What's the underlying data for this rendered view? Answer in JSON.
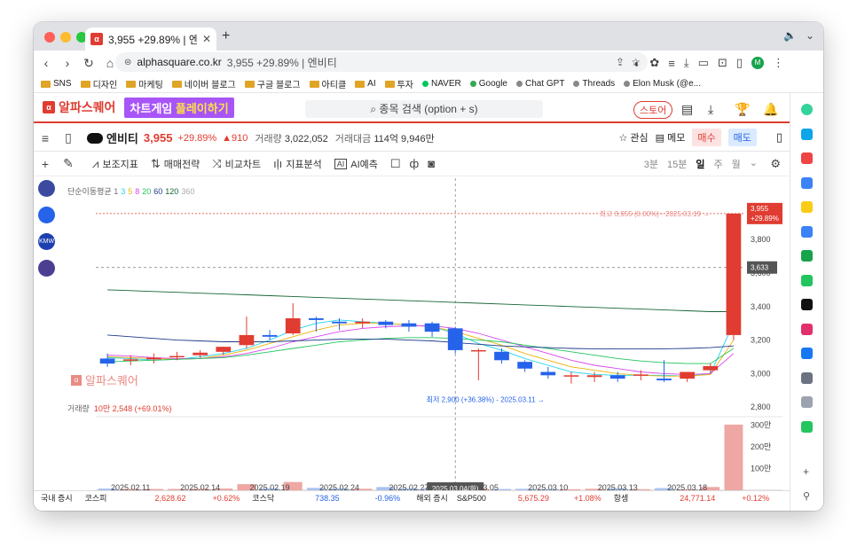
{
  "browser": {
    "tab_title": "3,955 +29.89% | 엔비티",
    "favicon": "α",
    "url_host": "alphasquare.co.kr",
    "url_rest": "3,955 +29.89% | 엔비티",
    "profile_initial": "M"
  },
  "bookmarks": [
    {
      "label": "SNS",
      "type": "folder"
    },
    {
      "label": "디자인",
      "type": "folder"
    },
    {
      "label": "마케팅",
      "type": "folder"
    },
    {
      "label": "네이버 블로그",
      "type": "folder"
    },
    {
      "label": "구글 블로그",
      "type": "folder"
    },
    {
      "label": "아티클",
      "type": "folder"
    },
    {
      "label": "AI",
      "type": "folder"
    },
    {
      "label": "투자",
      "type": "folder"
    },
    {
      "label": "NAVER",
      "type": "site",
      "color": "#03c75a"
    },
    {
      "label": "Google",
      "type": "site",
      "color": "#34a853"
    },
    {
      "label": "Chat GPT",
      "type": "site",
      "color": "#888888"
    },
    {
      "label": "Threads",
      "type": "site",
      "color": "#888888"
    },
    {
      "label": "Elon Musk (@e...",
      "type": "site",
      "color": "#888888"
    }
  ],
  "app": {
    "logo_text": "알파스퀘어",
    "promo_a": "차트게임 ",
    "promo_b": "플레이하기",
    "search_placeholder": "종목 검색 (option + s)",
    "store_label": "스토어"
  },
  "stock": {
    "name": "엔비티",
    "price": "3,955",
    "pct": "+29.89%",
    "change": "▲910",
    "volume_label": "거래량",
    "volume": "3,022,052",
    "amount_label": "거래대금",
    "amount": "114억 9,946만",
    "watch_label": "관심",
    "memo_label": "메모",
    "buy_label": "매수",
    "sell_label": "매도"
  },
  "chart_toolbar": {
    "indicator_label": "보조지표",
    "strategy_label": "매매전략",
    "compare_label": "비교차트",
    "analysis_label": "지표분석",
    "ai_label": "AI예측",
    "periods": [
      "3분",
      "15분",
      "일",
      "주",
      "월"
    ],
    "active_period": "일"
  },
  "overlays": {
    "ma_title": "단순이동평균",
    "ma_periods": [
      {
        "label": "1",
        "color": "#6b7280"
      },
      {
        "label": "3",
        "color": "#22d3ee"
      },
      {
        "label": "5",
        "color": "#eab308"
      },
      {
        "label": "8",
        "color": "#d946ef"
      },
      {
        "label": "20",
        "color": "#22c55e"
      },
      {
        "label": "60",
        "color": "#1e3a8a"
      },
      {
        "label": "120",
        "color": "#166534"
      },
      {
        "label": "360",
        "color": "#aaaaaa"
      }
    ],
    "high_label": "최고 3,955 (0.00%) - 2025.03.19 →",
    "low_label": "최저 2,900 (+36.38%) - 2025.03.11 →",
    "last_price_tag": "3,955",
    "last_pct_tag": "+29.89%",
    "cursor_price": "3,633",
    "cursor_date": "2025.03.04(화)",
    "volume_title": "거래량",
    "volume_value": "10만 2,548 (+69.01%)",
    "watermark": "알파스퀘어"
  },
  "chart_data": {
    "type": "candlestick",
    "price_axis": {
      "min": 2780,
      "max": 4060,
      "ticks": [
        2800,
        3000,
        3200,
        3400,
        3600,
        3800
      ],
      "tick_labels": [
        "2,800",
        "3,000",
        "3,200",
        "3,400",
        "3,600",
        "3,800"
      ]
    },
    "volume_axis": {
      "max": 3100000,
      "ticks": [
        1000000,
        2000000,
        3000000
      ],
      "tick_labels": [
        "100만",
        "200만",
        "300만"
      ]
    },
    "x_labels": [
      {
        "i": 1,
        "label": "2025.02.11"
      },
      {
        "i": 4,
        "label": "2025.02.14"
      },
      {
        "i": 7,
        "label": "2025.02.19"
      },
      {
        "i": 10,
        "label": "2025.02.24"
      },
      {
        "i": 13,
        "label": "2025.02.27"
      },
      {
        "i": 16,
        "label": "2025.03.05"
      },
      {
        "i": 19,
        "label": "2025.03.10"
      },
      {
        "i": 22,
        "label": "2025.03.13"
      },
      {
        "i": 25,
        "label": "2025.03.18"
      }
    ],
    "candles": [
      {
        "o": 3090,
        "h": 3120,
        "l": 3040,
        "c": 3060,
        "v": 80000
      },
      {
        "o": 3080,
        "h": 3110,
        "l": 3050,
        "c": 3085,
        "v": 60000
      },
      {
        "o": 3085,
        "h": 3120,
        "l": 3060,
        "c": 3095,
        "v": 60000
      },
      {
        "o": 3100,
        "h": 3130,
        "l": 3080,
        "c": 3105,
        "v": 60000
      },
      {
        "o": 3110,
        "h": 3140,
        "l": 3090,
        "c": 3125,
        "v": 70000
      },
      {
        "o": 3130,
        "h": 3160,
        "l": 3110,
        "c": 3160,
        "v": 80000
      },
      {
        "o": 3170,
        "h": 3340,
        "l": 3150,
        "c": 3230,
        "v": 280000
      },
      {
        "o": 3230,
        "h": 3260,
        "l": 3200,
        "c": 3220,
        "v": 90000
      },
      {
        "o": 3240,
        "h": 3420,
        "l": 3230,
        "c": 3330,
        "v": 380000
      },
      {
        "o": 3330,
        "h": 3340,
        "l": 3250,
        "c": 3320,
        "v": 110000
      },
      {
        "o": 3310,
        "h": 3330,
        "l": 3260,
        "c": 3300,
        "v": 90000
      },
      {
        "o": 3300,
        "h": 3330,
        "l": 3270,
        "c": 3310,
        "v": 70000
      },
      {
        "o": 3310,
        "h": 3320,
        "l": 3270,
        "c": 3290,
        "v": 150000
      },
      {
        "o": 3300,
        "h": 3320,
        "l": 3250,
        "c": 3280,
        "v": 90000
      },
      {
        "o": 3300,
        "h": 3310,
        "l": 3220,
        "c": 3250,
        "v": 100000
      },
      {
        "o": 3270,
        "h": 3280,
        "l": 3120,
        "c": 3140,
        "v": 120000
      },
      {
        "o": 3140,
        "h": 3150,
        "l": 2960,
        "c": 3140,
        "v": 80000
      },
      {
        "o": 3130,
        "h": 3150,
        "l": 3060,
        "c": 3080,
        "v": 60000
      },
      {
        "o": 3070,
        "h": 3080,
        "l": 3010,
        "c": 3030,
        "v": 70000
      },
      {
        "o": 3010,
        "h": 3040,
        "l": 2970,
        "c": 2990,
        "v": 60000
      },
      {
        "o": 2990,
        "h": 3010,
        "l": 2940,
        "c": 2990,
        "v": 50000
      },
      {
        "o": 2980,
        "h": 3010,
        "l": 2950,
        "c": 2990,
        "v": 70000
      },
      {
        "o": 2990,
        "h": 3010,
        "l": 2950,
        "c": 2970,
        "v": 90000
      },
      {
        "o": 2990,
        "h": 3020,
        "l": 2960,
        "c": 2995,
        "v": 50000
      },
      {
        "o": 2970,
        "h": 3080,
        "l": 2950,
        "c": 2960,
        "v": 100000
      },
      {
        "o": 2970,
        "h": 3000,
        "l": 2950,
        "c": 3010,
        "v": 40000
      },
      {
        "o": 3020,
        "h": 3060,
        "l": 3000,
        "c": 3045,
        "v": 150000
      },
      {
        "o": 3230,
        "h": 3955,
        "l": 3200,
        "c": 3955,
        "v": 3022052
      }
    ],
    "ma_lines": [
      {
        "name": "3",
        "color": "#22d3ee",
        "values": [
          3095,
          3090,
          3080,
          3085,
          3100,
          3120,
          3150,
          3200,
          3260,
          3300,
          3320,
          3310,
          3300,
          3290,
          3280,
          3240,
          3180,
          3140,
          3090,
          3050,
          3010,
          2995,
          2990,
          2990,
          2990,
          2985,
          3000,
          3300
        ]
      },
      {
        "name": "5",
        "color": "#eab308",
        "values": [
          3100,
          3095,
          3090,
          3085,
          3090,
          3110,
          3140,
          3180,
          3220,
          3260,
          3290,
          3300,
          3300,
          3290,
          3280,
          3250,
          3210,
          3170,
          3120,
          3080,
          3040,
          3020,
          3000,
          2990,
          2985,
          2985,
          2995,
          3200
        ]
      },
      {
        "name": "8",
        "color": "#d946ef",
        "values": [
          3110,
          3105,
          3095,
          3090,
          3090,
          3100,
          3120,
          3150,
          3190,
          3220,
          3250,
          3270,
          3280,
          3285,
          3285,
          3270,
          3240,
          3200,
          3160,
          3120,
          3080,
          3050,
          3030,
          3010,
          3000,
          2995,
          3000,
          3120
        ]
      },
      {
        "name": "20",
        "color": "#22c55e",
        "values": [
          3070,
          3075,
          3080,
          3085,
          3090,
          3095,
          3110,
          3130,
          3150,
          3170,
          3190,
          3200,
          3210,
          3215,
          3215,
          3210,
          3200,
          3190,
          3170,
          3150,
          3130,
          3110,
          3090,
          3075,
          3065,
          3060,
          3060,
          3150
        ]
      },
      {
        "name": "60",
        "color": "#1e3a8a",
        "values": [
          3230,
          3220,
          3210,
          3200,
          3195,
          3190,
          3190,
          3190,
          3195,
          3200,
          3205,
          3205,
          3205,
          3200,
          3195,
          3185,
          3175,
          3165,
          3160,
          3155,
          3150,
          3148,
          3147,
          3147,
          3148,
          3150,
          3155,
          3165
        ]
      },
      {
        "name": "120",
        "color": "#166534",
        "values": [
          3500,
          3495,
          3490,
          3485,
          3480,
          3475,
          3470,
          3465,
          3460,
          3455,
          3450,
          3445,
          3440,
          3435,
          3430,
          3425,
          3420,
          3415,
          3410,
          3405,
          3400,
          3395,
          3390,
          3385,
          3380,
          3375,
          3370,
          3370
        ]
      }
    ]
  },
  "ticker": {
    "domestic_label": "국내 증시",
    "kospi_label": "코스피",
    "kospi_value": "2,628.62",
    "kospi_pct": "+0.62%",
    "kosdaq_label": "코스닥",
    "kosdaq_value": "738.35",
    "kosdaq_pct": "-0.96%",
    "overseas_label": "해외 증시",
    "sp_label": "S&P500",
    "sp_value": "5,675.29",
    "sp_pct": "+1.08%",
    "hs_label": "항셍",
    "hs_value": "24,771.14",
    "hs_pct": "+0.12%"
  },
  "left_rail": [
    {
      "name": "rail-monitor-icon",
      "color": "#3b4aa0"
    },
    {
      "name": "rail-music-icon",
      "color": "#2563eb"
    },
    {
      "name": "rail-kmw-icon",
      "color": "#1e40af",
      "label": "KMW"
    },
    {
      "name": "rail-brand-icon",
      "color": "#4c3f91"
    }
  ],
  "right_rail": [
    {
      "name": "rr-extension-green-icon",
      "color": "#34d399"
    },
    {
      "name": "rr-bird-icon",
      "color": "#0ea5e9"
    },
    {
      "name": "rr-pocket-icon",
      "color": "#ef4444"
    },
    {
      "name": "rr-calendar-icon",
      "color": "#3b82f6"
    },
    {
      "name": "rr-star-icon",
      "color": "#facc15"
    },
    {
      "name": "rr-translate-icon",
      "color": "#3b82f6"
    },
    {
      "name": "rr-chart-icon",
      "color": "#16a34a"
    },
    {
      "name": "rr-map-icon",
      "color": "#22c55e"
    },
    {
      "name": "rr-tiktok-icon",
      "color": "#111111"
    },
    {
      "name": "rr-instagram-icon",
      "color": "#e1306c"
    },
    {
      "name": "rr-facebook-icon",
      "color": "#1877f2"
    },
    {
      "name": "rr-feather-icon",
      "color": "#6b7280"
    },
    {
      "name": "rr-avatar-icon",
      "color": "#9ca3af"
    },
    {
      "name": "rr-check-icon",
      "color": "#22c55e"
    }
  ]
}
